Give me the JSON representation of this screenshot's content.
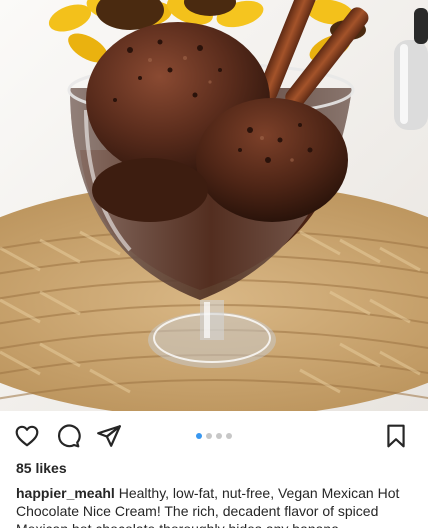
{
  "post": {
    "image": {
      "subject": "chocolate-ice-cream-photo"
    },
    "actions": {
      "like_icon": "heart-icon",
      "comment_icon": "comment-icon",
      "share_icon": "share-icon",
      "save_icon": "bookmark-icon"
    },
    "carousel": {
      "count": 4,
      "active_index": 0,
      "active_color": "#3897f0",
      "inactive_color": "#c7c7c7"
    },
    "likes": "85 likes",
    "caption": {
      "username": "happier_meahl",
      "text": "Healthy, low-fat, nut-free, Vegan Mexican Hot Chocolate Nice Cream! The rich, decadent flavor of spiced Mexican hot chocolate thoroughly hides any banana"
    }
  }
}
